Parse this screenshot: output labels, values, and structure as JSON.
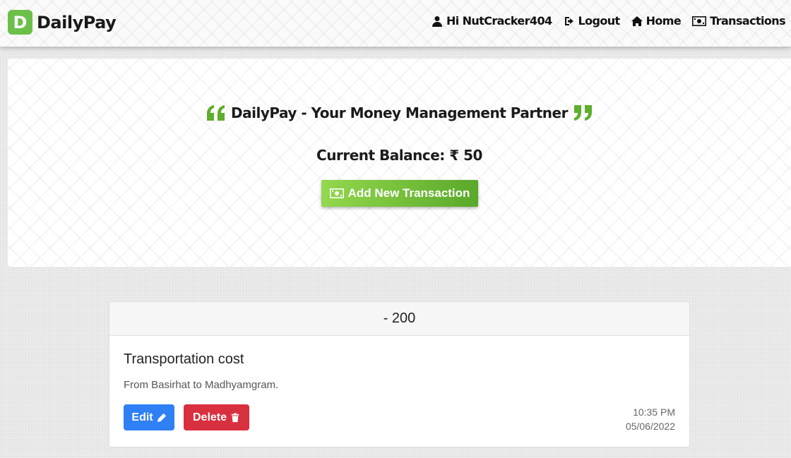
{
  "navbar": {
    "brand_letter": "D",
    "brand_name": "DailyPay",
    "greeting": "Hi NutCracker404",
    "logout": "Logout",
    "home": "Home",
    "transactions": "Transactions"
  },
  "hero": {
    "tagline": "DailyPay - Your Money Management Partner",
    "balance": "Current Balance: ₹ 50",
    "add_button": "Add New Transaction"
  },
  "transaction": {
    "amount": "- 200",
    "title": "Transportation cost",
    "description": "From Basirhat to Madhyamgram.",
    "edit_label": "Edit",
    "delete_label": "Delete",
    "time": "10:35 PM",
    "date": "05/06/2022"
  },
  "colors": {
    "brand_green": "#6cc04a",
    "button_green": "#5aa82a",
    "edit_blue": "#2f7ff5",
    "delete_red": "#d9303f"
  },
  "icons": [
    "user-icon",
    "sign-out-icon",
    "home-icon",
    "money-icon",
    "quote-left-icon",
    "quote-right-icon",
    "pencil-icon",
    "trash-icon"
  ]
}
